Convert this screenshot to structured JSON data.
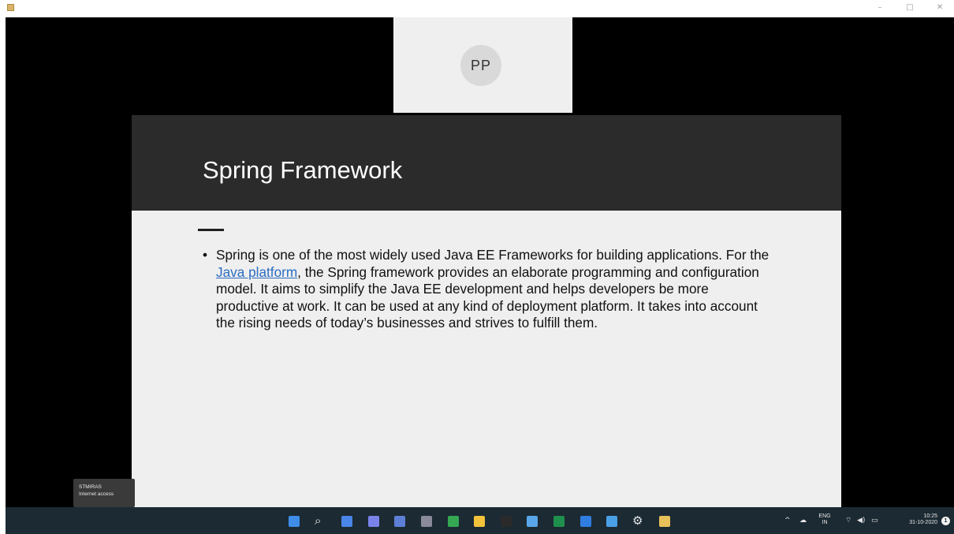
{
  "window": {
    "controls": {
      "minimize": "–",
      "maximize": "□",
      "close": "✕"
    }
  },
  "participant": {
    "initials": "PP"
  },
  "slide": {
    "title": "Spring Framework",
    "bullet_symbol": "•",
    "text_before_link": "Spring is one of the most widely used Java EE Frameworks for building applications. For the ",
    "link_text": "Java platform",
    "text_after_link": ", the Spring framework provides an elaborate programming and configuration model. It aims to simplify the Java EE development and helps developers be more productive at work. It can be used at any kind of deployment platform. It takes into account the rising needs of today’s businesses and strives to fulfill them."
  },
  "network_toast": {
    "name": "STMIRAS",
    "status": "Internet access"
  },
  "taskbar": {
    "icons": [
      {
        "name": "start-icon",
        "color": "#3e8ee8"
      },
      {
        "name": "search-icon",
        "glyph": "⌕"
      },
      {
        "name": "task-view-icon",
        "color": "#4a86e8"
      },
      {
        "name": "chat-icon",
        "color": "#7b83eb"
      },
      {
        "name": "meeting-app-icon",
        "color": "#5e7fd6"
      },
      {
        "name": "app-icon-6",
        "color": "#8a8a9a"
      },
      {
        "name": "chrome-icon",
        "color": "#34a853"
      },
      {
        "name": "file-explorer-icon",
        "color": "#f3c33c"
      },
      {
        "name": "terminal-icon",
        "color": "#2a2a2a"
      },
      {
        "name": "notepad-icon",
        "color": "#59a7e8"
      },
      {
        "name": "excel-icon",
        "color": "#1f8f4e"
      },
      {
        "name": "mail-icon",
        "color": "#2f7de1"
      },
      {
        "name": "photos-icon",
        "color": "#4aa0e6"
      },
      {
        "name": "settings-icon",
        "glyph": "⚙"
      },
      {
        "name": "powerpoint-active-icon",
        "color": "#e8c15a"
      }
    ],
    "tray": {
      "chevron": "^",
      "language_top": "ENG",
      "language_bottom": "IN",
      "time": "10:25",
      "date": "31-10-2020",
      "notification_count": "1"
    }
  }
}
